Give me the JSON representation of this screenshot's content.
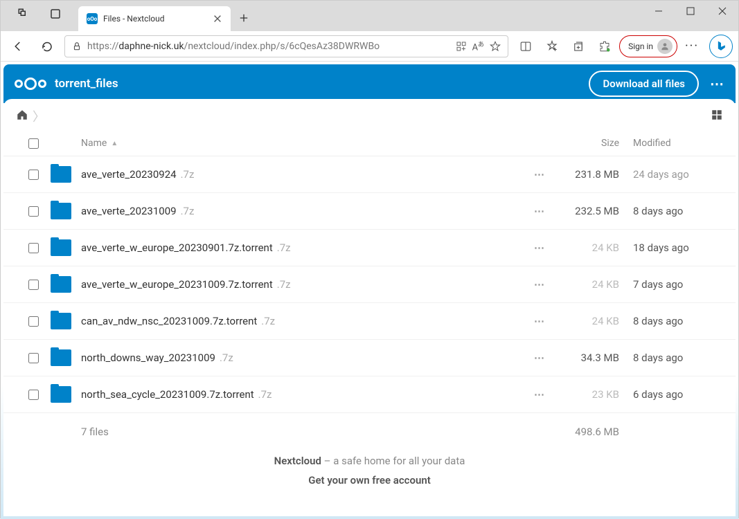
{
  "browser": {
    "tab_title": "Files - Nextcloud",
    "url_prefix": "https://",
    "url_host": "daphne-nick.uk",
    "url_path": "/nextcloud/index.php/s/6cQesAz38DWRWBo",
    "signin_label": "Sign in"
  },
  "header": {
    "folder_title": "torrent_files",
    "download_label": "Download all files"
  },
  "table": {
    "col_name": "Name",
    "col_size": "Size",
    "col_modified": "Modified"
  },
  "files": [
    {
      "name": "ave_verte_20230924",
      "ext": ".7z",
      "size": "231.8 MB",
      "size_dim": false,
      "modified": "24 days ago",
      "mod_dim": true
    },
    {
      "name": "ave_verte_20231009",
      "ext": ".7z",
      "size": "232.5 MB",
      "size_dim": false,
      "modified": "8 days ago",
      "mod_dim": false
    },
    {
      "name": "ave_verte_w_europe_20230901.7z.torrent",
      "ext": ".7z",
      "size": "24 KB",
      "size_dim": true,
      "modified": "18 days ago",
      "mod_dim": false
    },
    {
      "name": "ave_verte_w_europe_20231009.7z.torrent",
      "ext": ".7z",
      "size": "24 KB",
      "size_dim": true,
      "modified": "7 days ago",
      "mod_dim": false
    },
    {
      "name": "can_av_ndw_nsc_20231009.7z.torrent",
      "ext": ".7z",
      "size": "24 KB",
      "size_dim": true,
      "modified": "8 days ago",
      "mod_dim": false
    },
    {
      "name": "north_downs_way_20231009",
      "ext": ".7z",
      "size": "34.3 MB",
      "size_dim": false,
      "modified": "8 days ago",
      "mod_dim": false
    },
    {
      "name": "north_sea_cycle_20231009.7z.torrent",
      "ext": ".7z",
      "size": "23 KB",
      "size_dim": true,
      "modified": "6 days ago",
      "mod_dim": false
    }
  ],
  "summary": {
    "count": "7 files",
    "total_size": "498.6 MB"
  },
  "footer": {
    "brand": "Nextcloud",
    "tagline": " – a safe home for all your data",
    "cta": "Get your own free account"
  }
}
